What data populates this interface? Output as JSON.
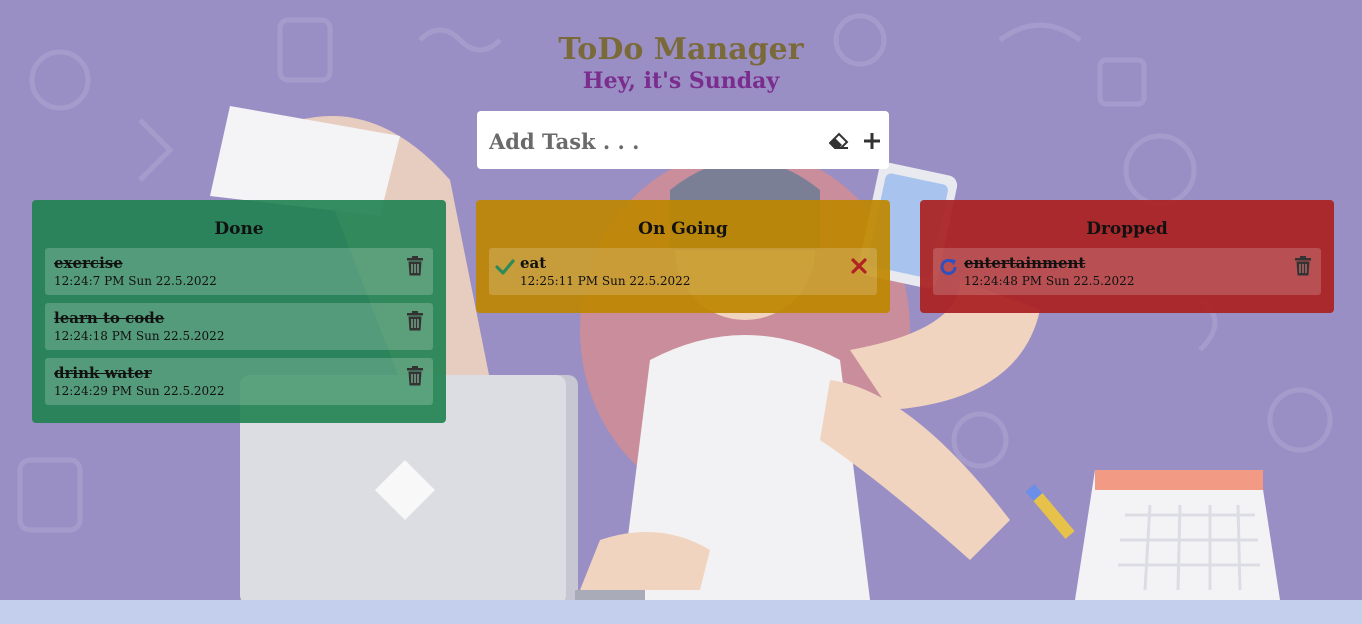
{
  "header": {
    "title": "ToDo Manager",
    "subtitle": "Hey, it's Sunday"
  },
  "add_task": {
    "placeholder": "Add Task . . .",
    "value": "",
    "clear_icon": "eraser-icon",
    "add_icon": "plus-icon"
  },
  "columns": {
    "done": {
      "title": "Done",
      "color": "#2e8b57",
      "tasks": [
        {
          "name": "exercise",
          "time": "12:24:7 PM Sun 22.5.2022"
        },
        {
          "name": "learn to code",
          "time": "12:24:18 PM Sun 22.5.2022"
        },
        {
          "name": "drink water",
          "time": "12:24:29 PM Sun 22.5.2022"
        }
      ]
    },
    "ongoing": {
      "title": "On Going",
      "color": "#b8860b",
      "tasks": [
        {
          "name": "eat",
          "time": "12:25:11 PM Sun 22.5.2022"
        }
      ]
    },
    "dropped": {
      "title": "Dropped",
      "color": "#a52a2a",
      "tasks": [
        {
          "name": "entertainment",
          "time": "12:24:48 PM Sun 22.5.2022"
        }
      ]
    }
  },
  "colors": {
    "background": "#9a8fc4",
    "title": "#7a6a3a",
    "subtitle": "#7b2d8e",
    "check": "#2e8b57",
    "cross": "#b22222",
    "restore": "#3050c0"
  }
}
